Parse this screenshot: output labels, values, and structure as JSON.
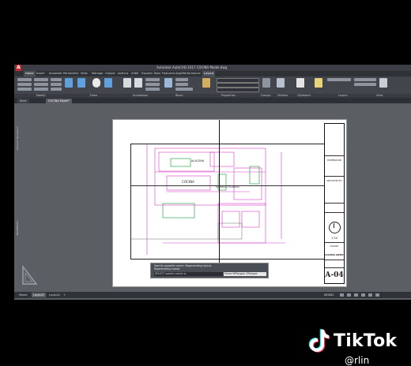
{
  "window": {
    "app_logo": "A",
    "title": "Autodesk AutoCAD 2017   COCINA Model.dwg"
  },
  "menu": [
    {
      "label": "Home",
      "active": true
    },
    {
      "label": "Insert"
    },
    {
      "label": "Annotate"
    },
    {
      "label": "Parametric"
    },
    {
      "label": "View"
    },
    {
      "label": "Manage"
    },
    {
      "label": "Output"
    },
    {
      "label": "Add-ins"
    },
    {
      "label": "A360"
    },
    {
      "label": "Express Tools"
    },
    {
      "label": "Featured Apps"
    },
    {
      "label": "Performance"
    },
    {
      "label": "Layout"
    }
  ],
  "ribbon": {
    "draw_tools": [
      "Move",
      "Rotate",
      "Trim",
      "Copy",
      "Mirror",
      "Fillet",
      "Stretch",
      "Scale",
      "Array",
      "Line",
      "Polyline",
      "Circle",
      "Arc"
    ],
    "annotation_tools": [
      "Text",
      "Dimension",
      "Linear",
      "Leader",
      "Table"
    ],
    "block_tools": [
      "Insert",
      "Create",
      "Edit",
      "Edit Attributes"
    ],
    "properties_tools": [
      "Match Properties",
      "ByLayer",
      "ByLayer",
      "ByLayer"
    ],
    "group_tools": [
      "Group"
    ],
    "utilities_tools": [
      "Measure"
    ],
    "clipboard_tools": [
      "Paste"
    ],
    "layer_tools": [
      "Layer Properties",
      "Make Current",
      "Match Layer"
    ],
    "view_tools": [
      "Base"
    ],
    "panels": [
      "Modify",
      "Draw",
      "Annotation",
      "Block",
      "Properties",
      "Groups",
      "Utilities",
      "Clipboard",
      "Layers",
      "View"
    ]
  },
  "doc_tabs": [
    {
      "label": "Start"
    },
    {
      "label": "COCINA Model*",
      "active": true
    }
  ],
  "drawing": {
    "room_labels": [
      "COCINA",
      "ALACENA",
      "ESPACIO PLANTA"
    ],
    "title_block": {
      "firm": "DISEÑADOR",
      "role": "ARQUITECTO",
      "scale_label": "1:50",
      "sheet_title": "PLANO",
      "subtitle": "COCINA ARMC.",
      "sheet_number": "A-04"
    }
  },
  "command": {
    "history": [
      "Specify opposite corner: Regenerating layout.",
      "Regenerating model."
    ],
    "prompt": "SELECT specify corner or",
    "dropdown": "Fence WPolygon CPolygon"
  },
  "status": {
    "model": "MODEL",
    "tabs": [
      {
        "label": "Model"
      },
      {
        "label": "Layout1",
        "active": true
      },
      {
        "label": "Layout2"
      }
    ]
  },
  "side_panel": {
    "navigation_label": "Viewport Navigation",
    "properties_label": "PROPERTIES"
  },
  "watermark": {
    "brand": "TikTok",
    "handle": "@rlin"
  },
  "colors": {
    "accent": "#5fa0dd",
    "logo_red": "#c8262b",
    "drawing_magenta": "#d23cc8",
    "drawing_green": "#2fa04a"
  }
}
